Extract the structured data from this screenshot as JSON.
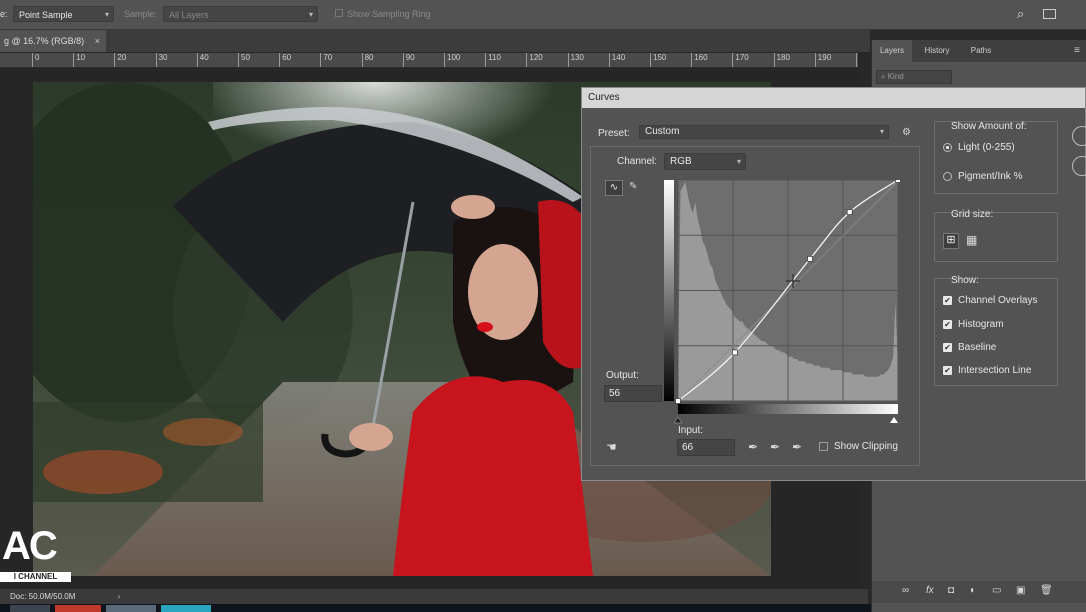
{
  "options_bar": {
    "sample_size_label": "e:",
    "sample_size_value": "Point Sample",
    "sample_label": "Sample:",
    "sample_value": "All Layers",
    "sampling_ring_label": "Show Sampling Ring"
  },
  "document": {
    "tab_title": "g @ 16.7% (RGB/8)",
    "close_glyph": "×",
    "ruler_ticks": [
      "0",
      "10",
      "20",
      "30",
      "40",
      "50",
      "60",
      "70",
      "80",
      "90",
      "100",
      "110",
      "120",
      "130",
      "140",
      "150",
      "160",
      "170",
      "180",
      "190",
      "2"
    ]
  },
  "status_bar": {
    "doc_info": "Doc: 50.0M/50.0M"
  },
  "panels": {
    "tabs": [
      "Layers",
      "History",
      "Paths"
    ],
    "kind_placeholder": "Kind"
  },
  "watermark": {
    "logo_text": "AC",
    "channel_text": "I CHANNEL"
  },
  "curves": {
    "title": "Curves",
    "preset_label": "Preset:",
    "preset_value": "Custom",
    "channel_label": "Channel:",
    "channel_value": "RGB",
    "output_label": "Output:",
    "output_value": "56",
    "input_label": "Input:",
    "input_value": "66",
    "show_clipping_label": "Show Clipping",
    "show_amount_label": "Show Amount of:",
    "light_label": "Light  (0-255)",
    "pigment_label": "Pigment/Ink %",
    "grid_size_label": "Grid size:",
    "show_label": "Show:",
    "show_options": [
      "Channel Overlays",
      "Histogram",
      "Baseline",
      "Intersection Line"
    ],
    "curve_points": [
      [
        0,
        0
      ],
      [
        66,
        56
      ],
      [
        153,
        164
      ],
      [
        199,
        218
      ],
      [
        255,
        255
      ]
    ],
    "histogram": [
      0.1,
      0.95,
      0.97,
      0.99,
      0.93,
      0.88,
      0.85,
      0.9,
      0.82,
      0.78,
      0.72,
      0.7,
      0.66,
      0.62,
      0.6,
      0.55,
      0.52,
      0.5,
      0.47,
      0.45,
      0.43,
      0.42,
      0.4,
      0.38,
      0.37,
      0.36,
      0.36,
      0.34,
      0.33,
      0.32,
      0.31,
      0.3,
      0.29,
      0.28,
      0.27,
      0.27,
      0.26,
      0.25,
      0.25,
      0.24,
      0.23,
      0.23,
      0.22,
      0.22,
      0.21,
      0.2,
      0.2,
      0.19,
      0.19,
      0.18,
      0.18,
      0.18,
      0.17,
      0.17,
      0.17,
      0.16,
      0.16,
      0.16,
      0.15,
      0.15,
      0.15,
      0.15,
      0.14,
      0.14,
      0.14,
      0.14,
      0.14,
      0.13,
      0.13,
      0.13,
      0.13,
      0.12,
      0.12,
      0.12,
      0.12,
      0.12,
      0.11,
      0.11,
      0.11,
      0.11,
      0.11,
      0.11,
      0.12,
      0.12,
      0.13,
      0.14,
      0.16,
      0.2,
      0.45,
      0.12
    ],
    "colors": {
      "curve": "#f0f0f0",
      "histogram": "#9a9a9a",
      "grid_bg": "#6e6e6e"
    }
  }
}
